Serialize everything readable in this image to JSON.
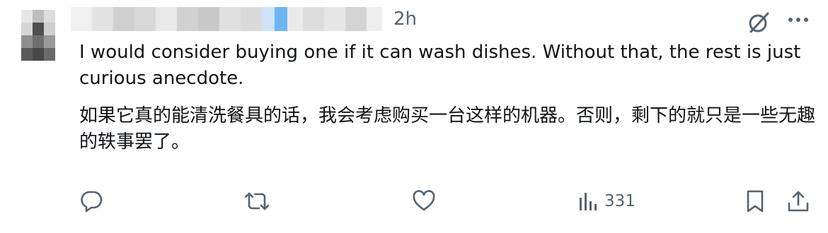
{
  "post": {
    "timestamp": "2h",
    "text_en": "I would consider buying one if it can wash dishes. Without that, the rest is just curious anecdote.",
    "text_zh": "如果它真的能清洗餐具的话，我会考虑购买一台这样的机器。否则，剩下的就只是一些无趣的轶事罢了。"
  },
  "actions": {
    "views_count": "331"
  },
  "icons": {
    "header": [
      "grok-icon",
      "more-icon"
    ],
    "actions": [
      "reply-icon",
      "retweet-icon",
      "like-icon",
      "views-icon",
      "bookmark-icon",
      "share-icon"
    ]
  },
  "colors": {
    "text": "#0f1419",
    "secondary": "#536471",
    "background": "#ffffff"
  }
}
